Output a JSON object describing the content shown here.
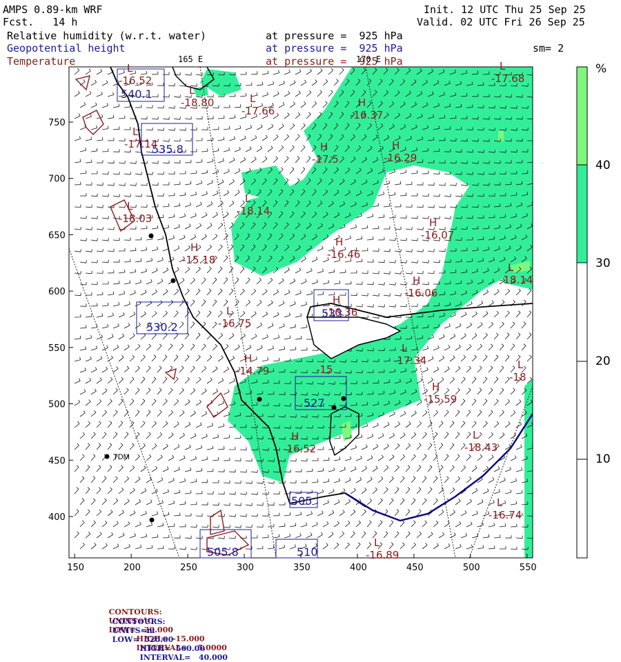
{
  "header": {
    "model": "AMPS 0.89-km WRF",
    "fcst": "Fcst.   14 h",
    "init": "Init. 12 UTC Thu 25 Sep 25",
    "valid": "Valid. 02 UTC Fri 26 Sep 25",
    "var1": "Relative humidity (w.r.t. water)",
    "var1_level": "at pressure =  925 hPa",
    "var2": "Geopotential height",
    "var2_level": "at pressure =  925 hPa",
    "var3": "Temperature",
    "var3_level": "at pressure =  925 hPa",
    "smoothing": "sm= 2",
    "lon_label_1": "165 E",
    "lon_label_2": "170 E"
  },
  "colorbar": {
    "unit": "%",
    "ticks": [
      "40",
      "30",
      "20",
      "10"
    ],
    "colors": {
      "light_green": "#7ef77e",
      "teal": "#33ee99",
      "white": "#ffffff"
    }
  },
  "axes": {
    "x_ticks": [
      "150",
      "200",
      "250",
      "300",
      "350",
      "400",
      "450",
      "500",
      "550"
    ],
    "y_ticks": [
      "750",
      "700",
      "650",
      "600",
      "550",
      "500",
      "450",
      "400"
    ]
  },
  "station": {
    "label": "TDM"
  },
  "temperature_labels": [
    {
      "text": "L",
      "v": "-16.52"
    },
    {
      "text": "L",
      "v": "-18.80"
    },
    {
      "text": "L",
      "v": "-17.66"
    },
    {
      "text": "H",
      "v": "-16.37"
    },
    {
      "text": "L",
      "v": "-17.68"
    },
    {
      "text": "L",
      "v": "-17.14"
    },
    {
      "text": "H",
      "v": "-17.5"
    },
    {
      "text": "H",
      "v": "-16.29"
    },
    {
      "text": "L",
      "v": "-18.03"
    },
    {
      "text": "L",
      "v": "-18.14"
    },
    {
      "text": "H",
      "v": "-16.07"
    },
    {
      "text": "H",
      "v": "-16.46"
    },
    {
      "text": "H",
      "v": "-15.18"
    },
    {
      "text": "H",
      "v": "-16.06"
    },
    {
      "text": "L",
      "v": "-18.14"
    },
    {
      "text": "L",
      "v": "-16.75"
    },
    {
      "text": "H",
      "v": "-16.36"
    },
    {
      "text": "L",
      "v": "-17.34"
    },
    {
      "text": "H",
      "v": "-14.79"
    },
    {
      "text": "L",
      "v": "-18"
    },
    {
      "text": "H",
      "v": "-15.59"
    },
    {
      "text": "L",
      "v": "-18.43"
    },
    {
      "text": "H",
      "v": "-16.52"
    },
    {
      "text": "L",
      "v": "-16.74"
    },
    {
      "text": "L",
      "v": "-16.89"
    },
    {
      "text": "",
      "v": "-15"
    }
  ],
  "height_labels": [
    "540.1",
    "535.8",
    "530.2",
    "527",
    "533",
    "505",
    "505.8",
    "510"
  ],
  "footer": {
    "temp_line": {
      "contours": "CONTOURS:",
      "units": "UNITS=°C",
      "low": "LOW=  -20.000",
      "high": "HIGH=  -15.000",
      "interval": "INTERVAL=    5.0000"
    },
    "height_line": {
      "contours": "CONTOURS:",
      "units": "UNITS=m",
      "low": "LOW=  520.00",
      "high": "HIGH=  560.00",
      "interval": "INTERVAL=   40.000"
    }
  }
}
